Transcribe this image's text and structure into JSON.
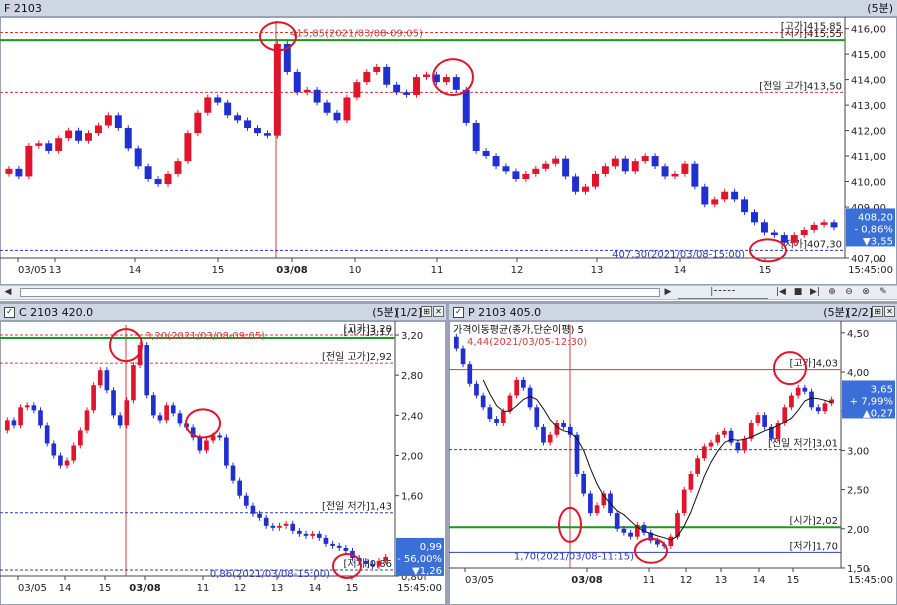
{
  "panels": {
    "top": {
      "title": "F 2103",
      "timeframe": "(5분)",
      "yticks": [
        "416,00",
        "415,00",
        "414,00",
        "413,00",
        "412,00",
        "411,00",
        "410,00",
        "409,00",
        "407,00"
      ],
      "xticks": [
        "03/05",
        "13",
        "14",
        "15",
        "03/08",
        "10",
        "11",
        "12",
        "13",
        "14",
        "15",
        "15:45:00"
      ],
      "annotations": {
        "high_text": "415,85(2021/03/08-09:05)",
        "low_text": "407,30(2021/03/08-15:00)",
        "label_high": "[고가]415,85",
        "label_open": "[시가]415,55",
        "label_prevhigh": "[전일 고가]413,50",
        "label_low": "[저가]407,30"
      },
      "price_box": {
        "price": "408,20",
        "pct": "- 0,86%",
        "chg": "▼3,55"
      }
    },
    "bottom_left": {
      "title": "C 2103 420.0",
      "timeframe": "(5분)",
      "page": "[1/2]",
      "yticks": [
        "3,20",
        "2,80",
        "2,40",
        "2,00",
        "1,60",
        "0,80"
      ],
      "xticks": [
        "03/05",
        "14",
        "15",
        "03/08",
        "11",
        "12",
        "13",
        "14",
        "15",
        "15:45:00"
      ],
      "annotations": {
        "high_text": "3,20(2021/03/08-09:05)",
        "low_text": "0,86(2021/03/08-15:00)",
        "label_high": "[고가]3,20",
        "label_open": "[시가]3,17",
        "label_prevhigh": "[전일 고가]2,92",
        "label_prevlow": "[전일 저가]1,43",
        "label_low": "[저가]0,86"
      },
      "price_box": {
        "price": "0,99",
        "pct": "- 56,00%",
        "chg": "▼1,26"
      }
    },
    "bottom_right": {
      "title": "P 2103 405.0",
      "timeframe": "(5분)",
      "page": "[2/2]",
      "indicator_label": "가격이동평균(종가,단순이평) 5",
      "yticks": [
        "4,50",
        "4,00",
        "3,50",
        "3,00",
        "2,50",
        "2,00",
        "1,50"
      ],
      "xticks": [
        "03/05",
        "03/08",
        "11",
        "12",
        "13",
        "14",
        "15",
        "15:45:00"
      ],
      "annotations": {
        "high_text": "4,44(2021/03/05-12:30)",
        "low_text": "1,70(2021/03/08-11:15)",
        "label_high": "[고가]4,03",
        "label_prevlow": "[전일 저가]3,01",
        "label_open": "[시가]2,02",
        "label_low": "[저가]1,70"
      },
      "price_box": {
        "price": "3,65",
        "pct": "+ 7,99%",
        "chg": "▲0,27"
      }
    }
  },
  "colors": {
    "up": "#e0142b",
    "down": "#1f2fd0",
    "green_line": "#1a9a1a",
    "red_dash": "#d23c3c",
    "blue_dash": "#2b3fb8",
    "ma": "#111111",
    "price_box": "#3a6fd8"
  },
  "chart_data": [
    {
      "type": "candlestick",
      "title": "F 2103",
      "ylim": [
        407.0,
        416.3
      ],
      "levels": {
        "high": 415.85,
        "open": 415.55,
        "prev_high": 413.5,
        "low": 407.3
      },
      "close_path": [
        410.5,
        410.2,
        411.4,
        411.5,
        411.2,
        411.7,
        412.0,
        411.6,
        411.9,
        412.2,
        412.6,
        412.1,
        411.3,
        410.6,
        410.1,
        409.9,
        410.3,
        410.8,
        411.9,
        412.7,
        413.3,
        413.1,
        412.6,
        412.4,
        412.1,
        411.9,
        411.8,
        415.4,
        414.3,
        413.5,
        413.6,
        413.1,
        412.7,
        412.4,
        413.3,
        413.9,
        414.3,
        414.5,
        413.8,
        413.5,
        413.4,
        414.1,
        414.2,
        413.9,
        414.1,
        413.6,
        412.3,
        411.2,
        411.0,
        410.6,
        410.4,
        410.1,
        410.3,
        410.5,
        410.7,
        410.9,
        410.2,
        409.6,
        409.8,
        410.3,
        410.6,
        410.9,
        410.4,
        410.8,
        411.0,
        410.6,
        410.2,
        410.3,
        410.7,
        409.8,
        409.1,
        409.3,
        409.6,
        409.3,
        408.8,
        408.4,
        408.0,
        407.9,
        407.6,
        407.9,
        408.1,
        408.3,
        408.4,
        408.2
      ],
      "pct_change": "-0.86%",
      "change": -3.55,
      "last": 408.2
    },
    {
      "type": "candlestick",
      "title": "C 2103 420.0",
      "ylim": [
        0.8,
        3.3
      ],
      "levels": {
        "high": 3.2,
        "open": 3.17,
        "prev_high": 2.92,
        "prev_low": 1.43,
        "low": 0.86
      },
      "close_path": [
        2.35,
        2.3,
        2.48,
        2.5,
        2.45,
        2.3,
        2.12,
        2.0,
        1.9,
        1.95,
        2.1,
        2.25,
        2.45,
        2.7,
        2.85,
        2.65,
        2.4,
        2.3,
        2.55,
        2.9,
        3.1,
        2.6,
        2.4,
        2.35,
        2.5,
        2.42,
        2.32,
        2.28,
        2.18,
        2.05,
        2.15,
        2.2,
        2.18,
        1.9,
        1.75,
        1.6,
        1.5,
        1.42,
        1.38,
        1.3,
        1.28,
        1.3,
        1.32,
        1.25,
        1.22,
        1.2,
        1.22,
        1.18,
        1.12,
        1.1,
        1.08,
        1.05,
        0.98,
        0.95,
        0.92,
        0.9,
        0.95,
        0.99
      ],
      "pct_change": "-56.00%",
      "change": -1.26,
      "last": 0.99
    },
    {
      "type": "candlestick",
      "title": "P 2103 405.0",
      "ylim": [
        1.5,
        4.6
      ],
      "indicator": "가격이동평균(종가,단순이평) 5",
      "levels": {
        "high": 4.03,
        "prev_low": 3.01,
        "open": 2.02,
        "low": 1.7
      },
      "close_path": [
        4.3,
        4.1,
        3.85,
        3.7,
        3.55,
        3.4,
        3.35,
        3.5,
        3.7,
        3.9,
        3.8,
        3.55,
        3.3,
        3.1,
        3.2,
        3.35,
        3.3,
        3.2,
        2.7,
        2.45,
        2.2,
        2.3,
        2.45,
        2.2,
        2.0,
        1.95,
        1.9,
        2.05,
        1.95,
        1.85,
        1.8,
        1.78,
        1.9,
        2.2,
        2.5,
        2.7,
        2.9,
        3.05,
        3.1,
        3.2,
        3.25,
        3.1,
        3.0,
        3.15,
        3.35,
        3.45,
        3.3,
        3.15,
        3.35,
        3.55,
        3.7,
        3.8,
        3.75,
        3.55,
        3.5,
        3.6,
        3.65
      ],
      "pct_change": "+7.99%",
      "change": 0.27,
      "last": 3.65
    }
  ]
}
